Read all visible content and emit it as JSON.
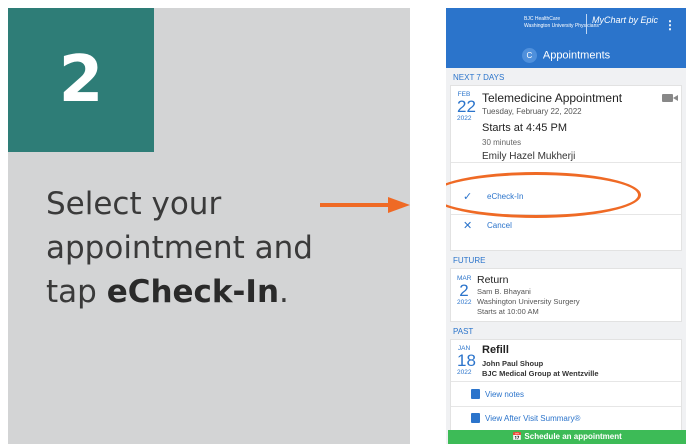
{
  "step": {
    "number": "2",
    "text_lines": [
      "Select your",
      "appointment and"
    ],
    "text_tap": "tap ",
    "text_bold": "eCheck-In",
    "text_end": "."
  },
  "colors": {
    "teal": "#2e7d77",
    "arrow": "#ef6a25",
    "epic_blue": "#2b74cb",
    "green": "#3dbb57"
  },
  "phone": {
    "brand_left_1": "BJC HealthCare",
    "brand_left_2": "Washington University Physicians",
    "brand_right": "MyChart by Epic",
    "tab_initial": "C",
    "tab_label": "Appointments",
    "next_header": "NEXT 7 DAYS",
    "next_appt": {
      "month": "FEB",
      "day": "22",
      "year": "2022",
      "title": "Telemedicine Appointment",
      "date_text": "Tuesday, February 22, 2022",
      "starts": "Starts at 4:45 PM",
      "duration": "30 minutes",
      "provider": "Emily Hazel Mukherji",
      "echeckin": "eCheck-In",
      "cancel": "Cancel"
    },
    "future_header": "FUTURE",
    "future_appt": {
      "month": "MAR",
      "day": "2",
      "year": "2022",
      "title": "Return",
      "provider": "Sam B. Bhayani",
      "dept": "Washington University Surgery",
      "starts": "Starts at 10:00 AM"
    },
    "past_header": "PAST",
    "past_appt": {
      "month": "JAN",
      "day": "18",
      "year": "2022",
      "title": "Refill",
      "provider": "John Paul Shoup",
      "dept": "BJC Medical Group at Wentzville"
    },
    "view_notes": "View notes",
    "view_avs": "View After Visit Summary®",
    "schedule": "Schedule an appointment"
  }
}
